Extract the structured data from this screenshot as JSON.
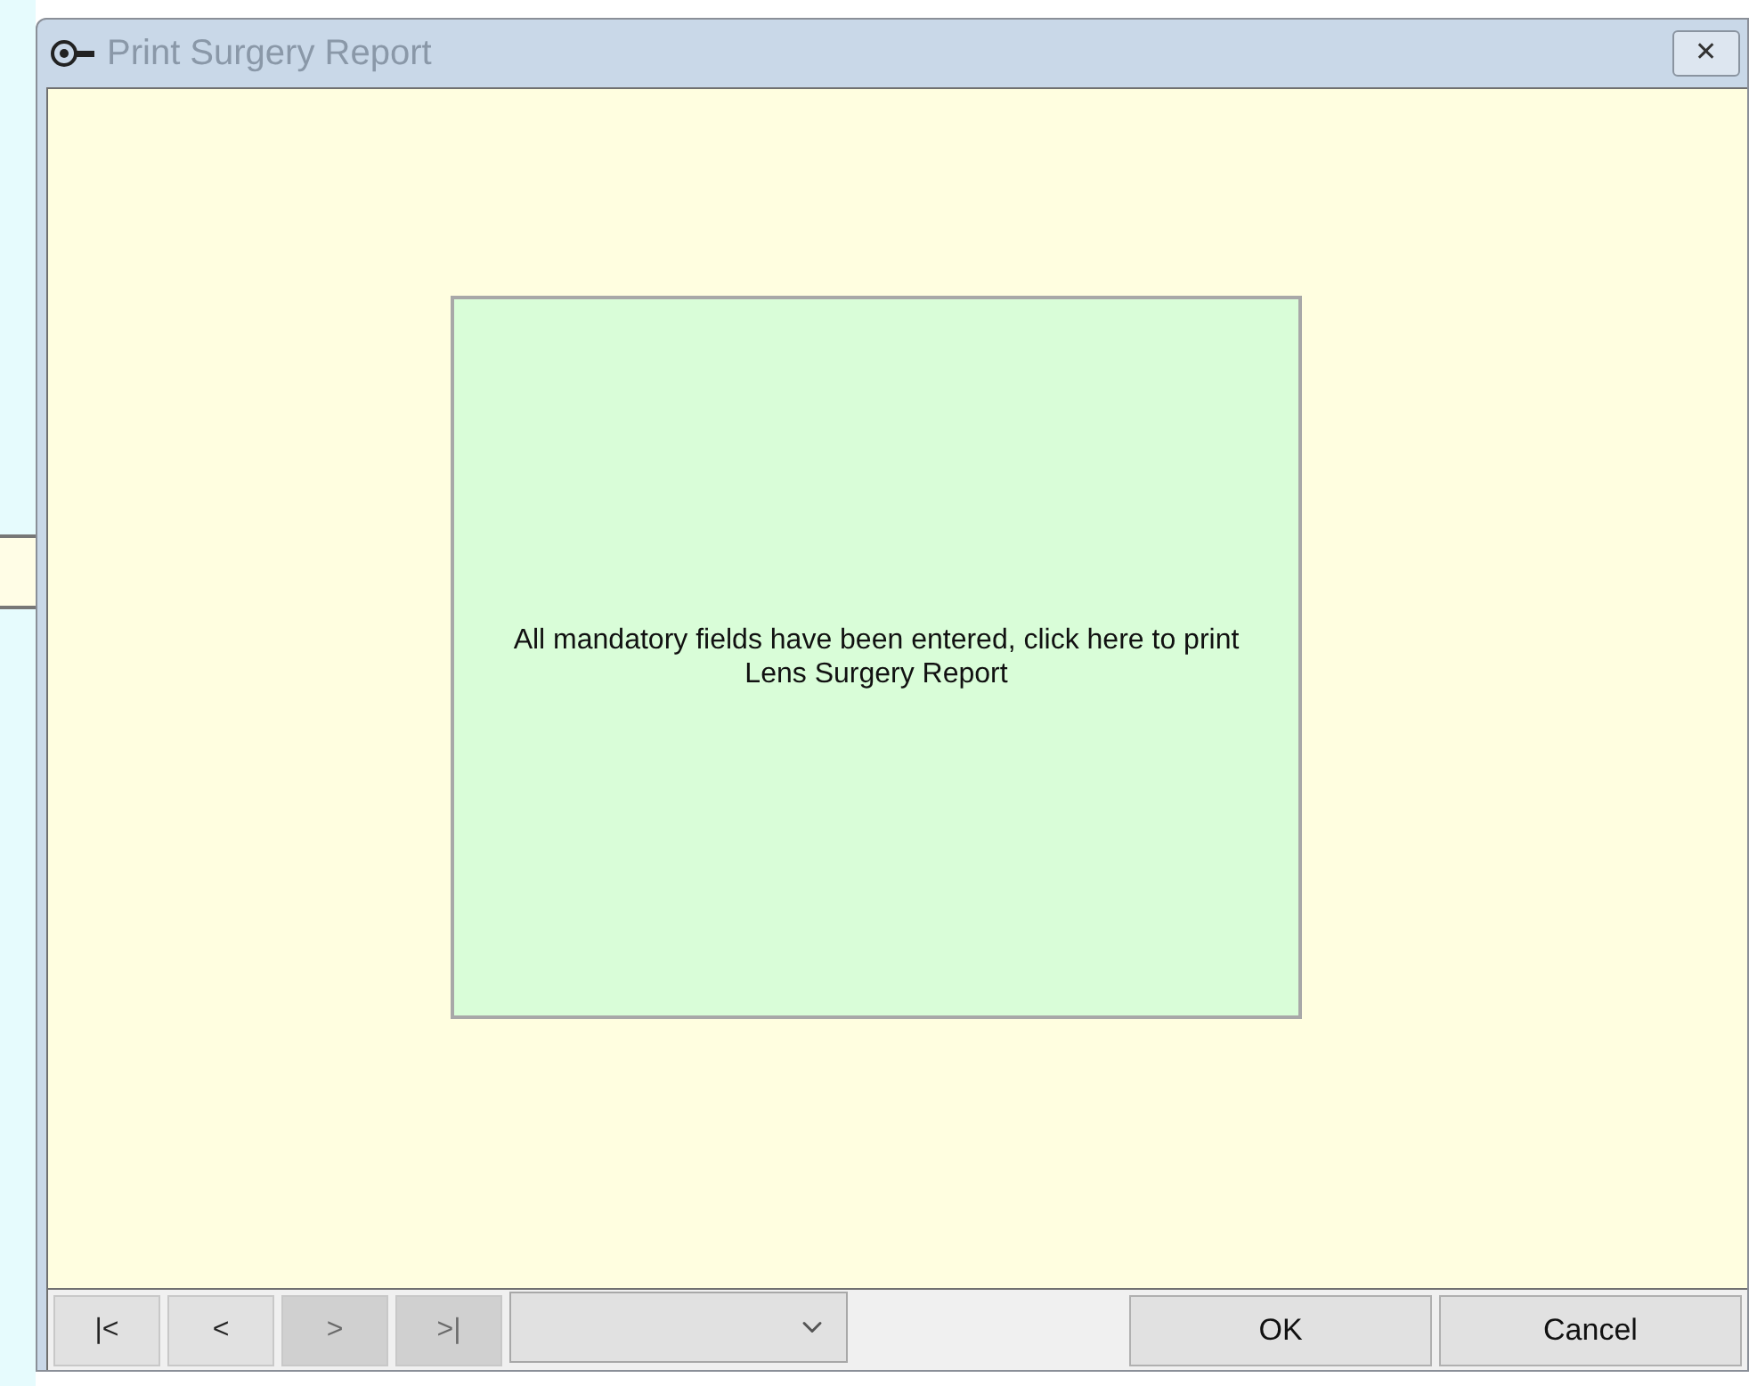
{
  "window": {
    "title": "Print Surgery Report",
    "close": "✕"
  },
  "print_button": {
    "label": "All mandatory fields have been entered, click here to print Lens Surgery Report"
  },
  "navigation": [
    {
      "label": "|<",
      "disabled": false
    },
    {
      "label": "<",
      "disabled": false
    },
    {
      "label": ">",
      "disabled": true
    },
    {
      "label": ">|",
      "disabled": true
    }
  ],
  "buttons": [
    {
      "label": "OK"
    },
    {
      "label": "Cancel"
    }
  ]
}
